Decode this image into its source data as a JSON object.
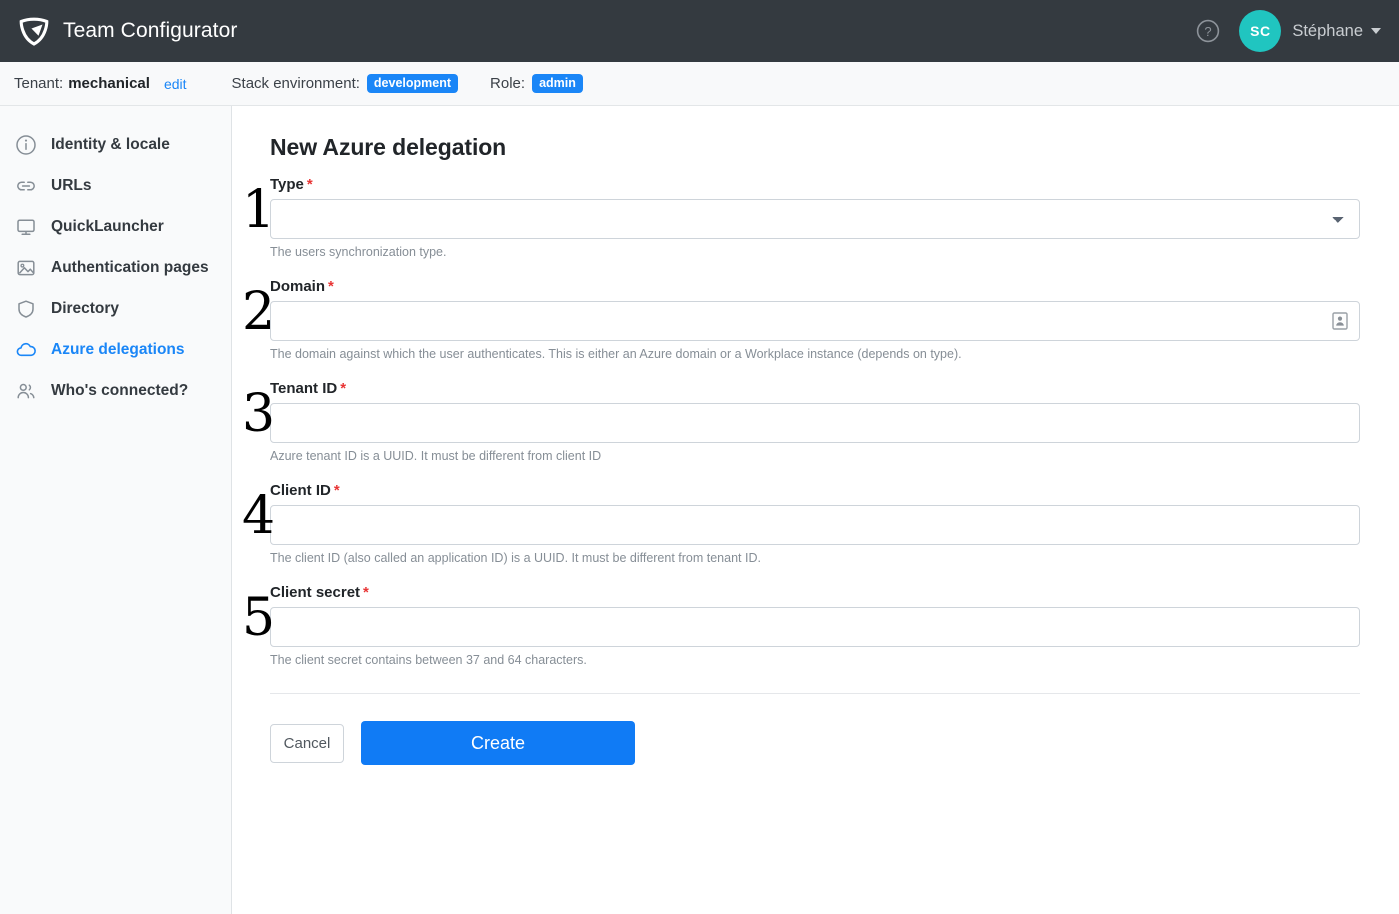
{
  "header": {
    "logo_icon": "shield-swoosh-logo",
    "title": "Team Configurator",
    "help_icon": "question-circle-icon",
    "user": {
      "initials": "SC",
      "name": "Stéphane",
      "avatar_color": "#20c5c0",
      "caret_icon": "chevron-down-icon"
    }
  },
  "context_bar": {
    "tenant_label": "Tenant:",
    "tenant_value": "mechanical",
    "tenant_edit_link": "edit",
    "stack_label": "Stack environment:",
    "stack_badge": "development",
    "role_label": "Role:",
    "role_badge": "admin",
    "badge_color": "#1a86f7"
  },
  "sidebar": {
    "items": [
      {
        "label": "Identity & locale",
        "icon": "info-circle-icon",
        "active": false
      },
      {
        "label": "URLs",
        "icon": "link-icon",
        "active": false
      },
      {
        "label": "QuickLauncher",
        "icon": "monitor-icon",
        "active": false
      },
      {
        "label": "Authentication pages",
        "icon": "image-icon",
        "active": false
      },
      {
        "label": "Directory",
        "icon": "shield-icon",
        "active": false
      },
      {
        "label": "Azure delegations",
        "icon": "cloud-icon",
        "active": true
      },
      {
        "label": "Who's connected?",
        "icon": "users-icon",
        "active": false
      }
    ],
    "active_color": "#1a86f7"
  },
  "main": {
    "page_title": "New Azure delegation",
    "required_marker": "*",
    "fields": [
      {
        "step": "1",
        "label": "Type",
        "required": true,
        "control": "select",
        "value": "",
        "placeholder": "",
        "help": "The users synchronization type.",
        "options": [
          ""
        ]
      },
      {
        "step": "2",
        "label": "Domain",
        "required": true,
        "control": "text",
        "value": "",
        "placeholder": "",
        "help": "The domain against which the user authenticates. This is either an Azure domain or a Workplace instance (depends on type).",
        "inner_icon": "contact-card-icon"
      },
      {
        "step": "3",
        "label": "Tenant ID",
        "required": true,
        "control": "text",
        "value": "",
        "placeholder": "",
        "help": "Azure tenant ID is a UUID. It must be different from client ID"
      },
      {
        "step": "4",
        "label": "Client ID",
        "required": true,
        "control": "text",
        "value": "",
        "placeholder": "",
        "help": "The client ID (also called an application ID) is a UUID. It must be different from tenant ID."
      },
      {
        "step": "5",
        "label": "Client secret",
        "required": true,
        "control": "text",
        "value": "",
        "placeholder": "",
        "help": "The client secret contains between 37 and 64 characters."
      }
    ],
    "actions": {
      "cancel_label": "Cancel",
      "create_label": "Create",
      "create_color": "#107bf5"
    }
  }
}
